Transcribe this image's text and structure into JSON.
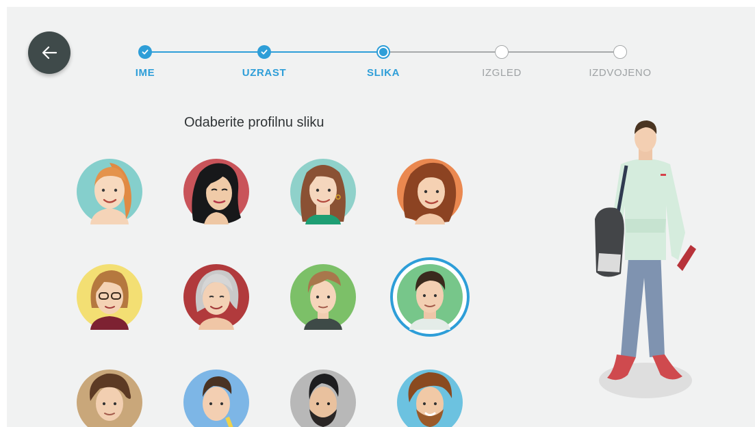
{
  "back_button": {
    "icon": "arrow-left-icon"
  },
  "stepper": {
    "steps": [
      {
        "label": "IME",
        "state": "done"
      },
      {
        "label": "UZRAST",
        "state": "done"
      },
      {
        "label": "SLIKA",
        "state": "current"
      },
      {
        "label": "IZGLED",
        "state": "todo"
      },
      {
        "label": "IZDVOJENO",
        "state": "todo"
      }
    ]
  },
  "main": {
    "heading": "Odaberite profilnu sliku",
    "selected_avatar": 8
  },
  "colors": {
    "accent": "#2e9ed8",
    "background": "#f1f2f2",
    "back_button": "#3f4a4a",
    "inactive": "#9ea2a4"
  }
}
